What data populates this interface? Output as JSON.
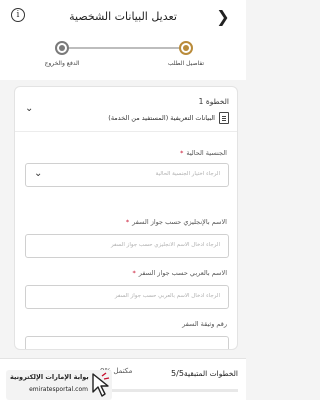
{
  "header": {
    "title": "تعديل البيانات الشخصية",
    "back_icon": "chevron-left-icon",
    "info_icon": "info-icon",
    "info_glyph": "i"
  },
  "stepper": {
    "step1_label": "تفاصيل الطلب",
    "step2_label": "الدفع والخروج",
    "accent": "#b98b3a"
  },
  "card": {
    "step_no": "الخطوة 1",
    "section_title": "البيانات التعريفية  (المستفيد من الخدمة)",
    "fields": [
      {
        "label": "الجنسية الحالية",
        "required": true,
        "placeholder": "الرجاء اختيار الجنسية الحالية"
      },
      {
        "label": "الاسم بالإنجليزي حسب جواز السفر",
        "required": true,
        "placeholder": "الرجاء ادخال الاسم الانجليزي حسب جواز السفر"
      },
      {
        "label": "الاسم بالعربي حسب جواز السفر",
        "required": true,
        "placeholder": "الرجاء ادخال الاسم بالعربي حسب جواز السفر"
      },
      {
        "label": "رقم وثيقة السفر",
        "required": false,
        "placeholder": ""
      }
    ]
  },
  "footer": {
    "steps_label": "الخطوات المتبقية",
    "steps_count": "5/5",
    "progress_text": "0% مكتمل",
    "progress_fraction": 0
  },
  "watermark": {
    "line1": "بوابة الإمارات الإلكترونية",
    "line2": "emiratesportal.com"
  },
  "required_mark": "*"
}
